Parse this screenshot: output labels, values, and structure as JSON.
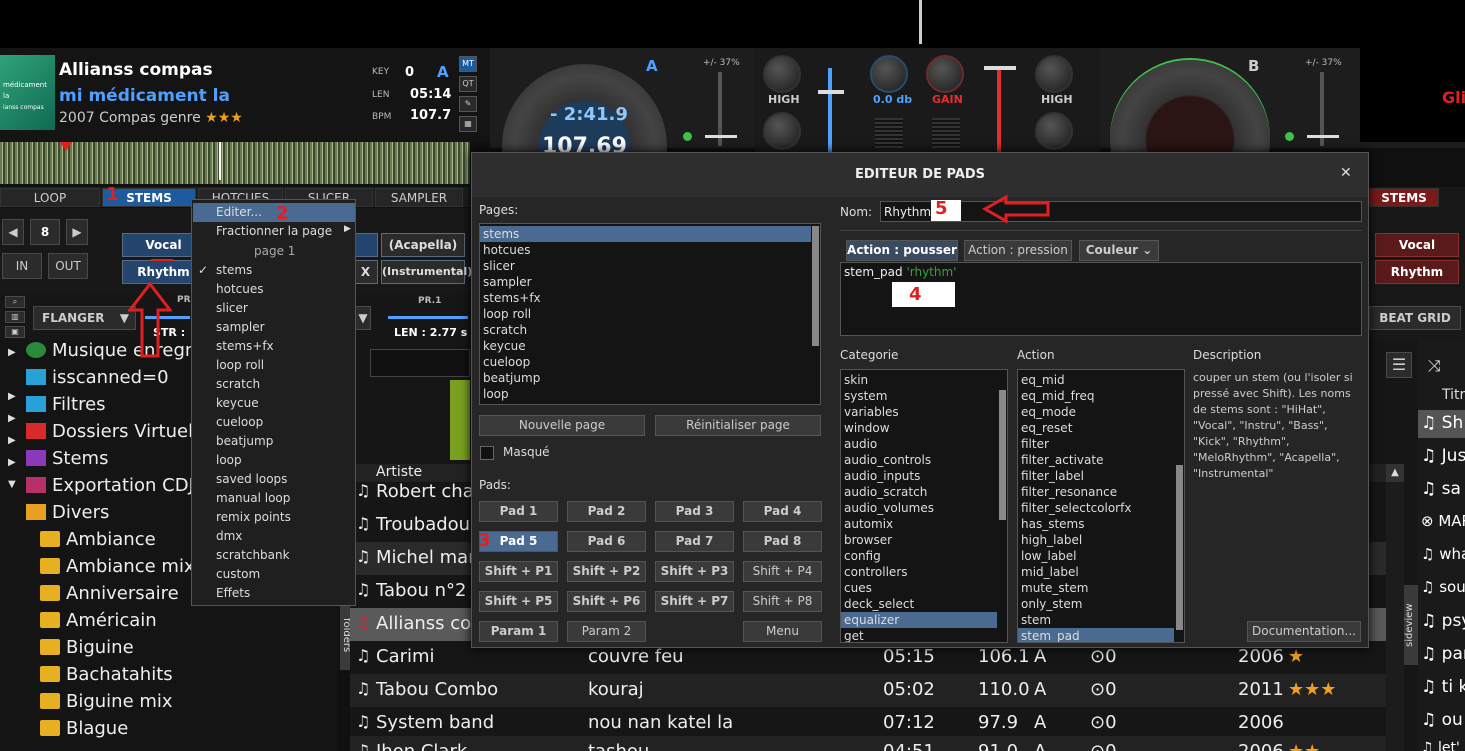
{
  "deckA": {
    "title": "Allianss compas",
    "artist": "mi médicament la",
    "year_genre": "2007 Compas genre",
    "stars": "★★★",
    "cover_text": "médicament la",
    "cover_sub": "ianss compas",
    "key_label": "KEY",
    "key_val": "0",
    "key_letter": "A",
    "len_label": "LEN",
    "len_val": "05:14",
    "bpm_label": "BPM",
    "bpm_val": "107.7",
    "side_buttons": [
      "MT",
      "QT"
    ],
    "deck_letter": "A",
    "pitch": "+/- 37%",
    "time_remaining": "- 2:41.9",
    "bpm_big": "107.69",
    "tabs": [
      "LOOP",
      "STEMS",
      "HOTCUES",
      "SLICER",
      "SAMPLER"
    ],
    "loop_size": "8",
    "loop_in": "IN",
    "loop_out": "OUT",
    "vocal": "Vocal",
    "rhythm": "Rhythm",
    "acapella": "(Acapella)",
    "instrumental": "(Instrumental)",
    "x_btn": "X",
    "effect": "FLANGER",
    "pr_label": "PR",
    "pr1": "PR.1",
    "str_label": "STR :",
    "len_info": "LEN :  2.77 s"
  },
  "mixer": {
    "high_left": "HIGH",
    "db": "0.0 db",
    "gain": "GAIN",
    "high_right": "HIGH"
  },
  "deckB": {
    "deck_letter": "B",
    "pitch": "+/- 37%",
    "tab_stems": "STEMS",
    "vocal": "Vocal",
    "rhythm": "Rhythm",
    "beat_grid": "BEAT GRID",
    "partial_title": "Gli"
  },
  "tree": [
    "Musique enregne",
    "isscanned=0",
    "Filtres",
    "Dossiers Virtuel",
    "Stems",
    "Exportation CDJ",
    "Divers",
    "Ambiance",
    "Ambiance mix",
    "Anniversaire",
    "Américain",
    "Biguine",
    "Bachatahits",
    "Biguine mix",
    "Blague"
  ],
  "list": {
    "header_artist": "Artiste",
    "rows": [
      {
        "title": "Robert char",
        "artist": "",
        "len": "",
        "bpm": "",
        "key": "",
        "play": "",
        "year": "",
        "stars": ""
      },
      {
        "title": "Troubadour",
        "artist": "",
        "len": "",
        "bpm": "",
        "key": "",
        "play": "",
        "year": "",
        "stars": ""
      },
      {
        "title": "Michel mart",
        "artist": "",
        "len": "",
        "bpm": "",
        "key": "",
        "play": "",
        "year": "",
        "stars": ""
      },
      {
        "title": "Tabou n°2",
        "artist": "",
        "len": "",
        "bpm": "",
        "key": "",
        "play": "",
        "year": "",
        "stars": ""
      },
      {
        "title": "Allianss cor",
        "artist": "",
        "len": "",
        "bpm": "",
        "key": "",
        "play": "",
        "year": "",
        "stars": ""
      },
      {
        "title": "Carimi",
        "artist": "couvre feu",
        "len": "05:15",
        "bpm": "106.1",
        "key": "A",
        "play": "⊙0",
        "year": "2006",
        "stars": "★"
      },
      {
        "title": "Tabou Combo",
        "artist": "kouraj",
        "len": "05:02",
        "bpm": "110.0",
        "key": "A",
        "play": "⊙0",
        "year": "2011",
        "stars": "★★★"
      },
      {
        "title": "System band",
        "artist": "nou nan katel la",
        "len": "07:12",
        "bpm": "97.9",
        "key": "A",
        "play": "⊙0",
        "year": "2006",
        "stars": ""
      },
      {
        "title": "Jhon Clark",
        "artist": "tashou",
        "len": "04:51",
        "bpm": "91.0",
        "key": "A",
        "play": "⊙0",
        "year": "2006",
        "stars": "★★"
      }
    ],
    "right_rows": [
      "Sh",
      "Jus",
      "sa",
      "MAR",
      "wha",
      "souk",
      "psy",
      "par",
      "ti k",
      "ou",
      "let'"
    ],
    "right_header": "Titr",
    "folders_tab": "folders",
    "sideview_tab": "sideview"
  },
  "context_menu": {
    "items": [
      "Editer...",
      "Fractionner la page",
      "page 1",
      "stems",
      "hotcues",
      "slicer",
      "sampler",
      "stems+fx",
      "loop roll",
      "scratch",
      "keycue",
      "cueloop",
      "beatjump",
      "loop",
      "saved loops",
      "manual loop",
      "remix points",
      "dmx",
      "scratchbank",
      "custom",
      "Effets"
    ]
  },
  "dialog": {
    "title": "EDITEUR DE PADS",
    "close": "✕",
    "pages_label": "Pages:",
    "pages": [
      "stems",
      "hotcues",
      "slicer",
      "sampler",
      "stems+fx",
      "loop roll",
      "scratch",
      "keycue",
      "cueloop",
      "beatjump",
      "loop"
    ],
    "new_page": "Nouvelle page",
    "reset_page": "Réinitialiser page",
    "masked": "Masqué",
    "pads_label": "Pads:",
    "pads": [
      "Pad 1",
      "Pad 2",
      "Pad 3",
      "Pad 4",
      "Pad 5",
      "Pad 6",
      "Pad 7",
      "Pad 8",
      "Shift + P1",
      "Shift + P2",
      "Shift + P3",
      "Shift + P4",
      "Shift + P5",
      "Shift + P6",
      "Shift + P7",
      "Shift + P8"
    ],
    "param1": "Param 1",
    "param2": "Param 2",
    "menu": "Menu",
    "name_label": "Nom:",
    "name_value": "Rhythm",
    "tab_push": "Action : pousser",
    "tab_press": "Action : pression",
    "tab_color": "Couleur",
    "script_cmd": "stem_pad",
    "script_arg": "'rhythm'",
    "categorie_label": "Categorie",
    "categories": [
      "skin",
      "system",
      "variables",
      "window",
      "audio",
      "audio_controls",
      "audio_inputs",
      "audio_scratch",
      "audio_volumes",
      "automix",
      "browser",
      "config",
      "controllers",
      "cues",
      "deck_select",
      "equalizer",
      "get"
    ],
    "action_label": "Action",
    "actions": [
      "eq_mid",
      "eq_mid_freq",
      "eq_mode",
      "eq_reset",
      "filter",
      "filter_activate",
      "filter_label",
      "filter_resonance",
      "filter_selectcolorfx",
      "has_stems",
      "high_label",
      "low_label",
      "mid_label",
      "mute_stem",
      "only_stem",
      "stem",
      "stem_pad"
    ],
    "description_label": "Description",
    "description": "couper un stem (ou l'isoler si pressé avec Shift). Les noms de stems sont : \"HiHat\", \"Vocal\", \"Instru\", \"Bass\", \"Kick\", \"Rhythm\", \"MeloRhythm\", \"Acapella\", \"Instrumental\"",
    "documentation": "Documentation..."
  },
  "markers": [
    "1",
    "2",
    "3",
    "4",
    "5"
  ]
}
